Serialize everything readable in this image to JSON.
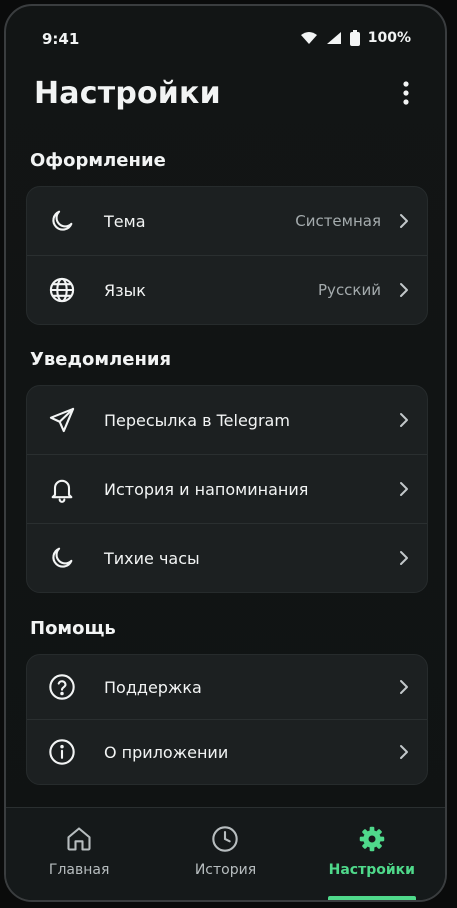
{
  "status_bar": {
    "time": "9:41",
    "battery": "100%"
  },
  "header": {
    "title": "Настройки"
  },
  "sections": [
    {
      "title": "Оформление",
      "items": [
        {
          "label": "Тема",
          "value": "Системная",
          "icon": "moon-icon"
        },
        {
          "label": "Язык",
          "value": "Русский",
          "icon": "globe-icon"
        }
      ]
    },
    {
      "title": "Уведомления",
      "items": [
        {
          "label": "Пересылка в Telegram",
          "icon": "send-icon"
        },
        {
          "label": "История и напоминания",
          "icon": "bell-icon"
        },
        {
          "label": "Тихие часы",
          "icon": "moon-icon"
        }
      ]
    },
    {
      "title": "Помощь",
      "items": [
        {
          "label": "Поддержка",
          "icon": "help-circle-icon"
        },
        {
          "label": "О приложении",
          "icon": "info-circle-icon"
        }
      ]
    }
  ],
  "nav": [
    {
      "label": "Главная",
      "icon": "home-icon"
    },
    {
      "label": "История",
      "icon": "clock-icon"
    },
    {
      "label": "Настройки",
      "icon": "gear-icon",
      "active": true
    }
  ],
  "colors": {
    "accent": "#4fd98b",
    "background": "#121515",
    "card": "#1c2021",
    "text": "#f2f4f4",
    "secondary_text": "#a4abad"
  }
}
